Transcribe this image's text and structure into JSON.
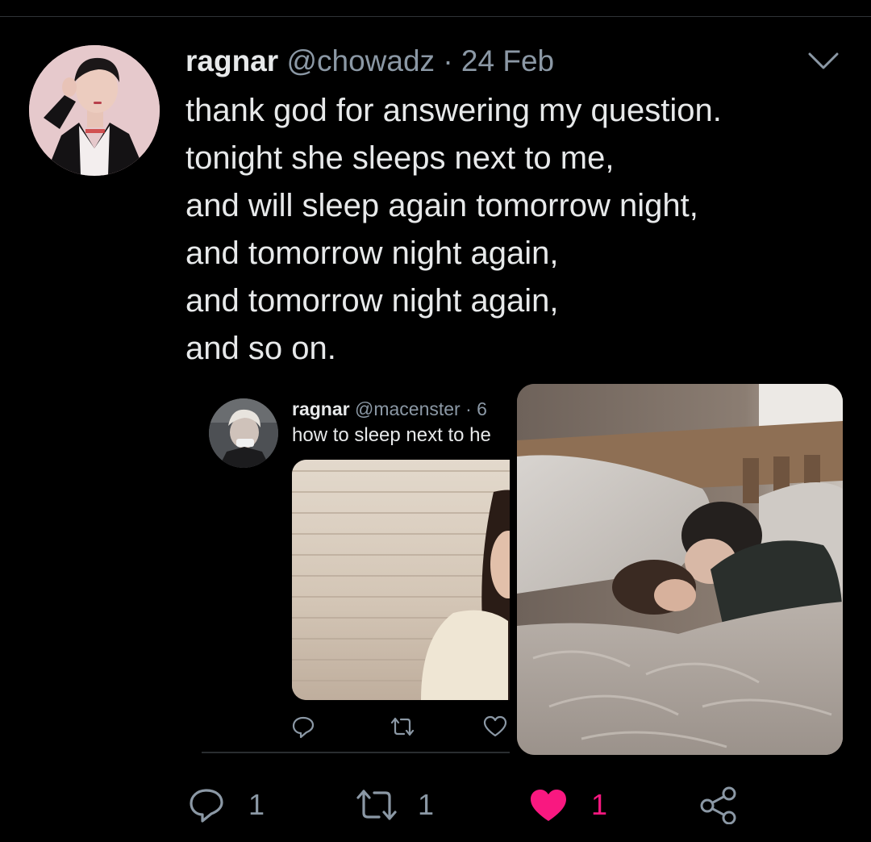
{
  "tweet": {
    "display_name": "ragnar",
    "handle": "@chowadz",
    "separator": "·",
    "date": "24 Feb",
    "lines": [
      "thank god for answering my question.",
      "tonight she sleeps next to me,",
      "and will sleep again tomorrow night,",
      "and tomorrow night again,",
      "and tomorrow night again,",
      "and so on."
    ]
  },
  "quoted": {
    "display_name": "ragnar",
    "handle_fragment": "@macenster · 6",
    "text_fragment": "how to sleep next to he"
  },
  "actions": {
    "reply_count": "1",
    "retweet_count": "1",
    "like_count": "1"
  },
  "icons": {
    "caret": "chevron-down-icon",
    "reply": "reply-icon",
    "retweet": "retweet-icon",
    "like": "heart-icon",
    "share": "share-icon"
  },
  "colors": {
    "background": "#000000",
    "text": "#e7e9ea",
    "secondary_text": "#8b98a5",
    "like_active": "#f91880"
  }
}
